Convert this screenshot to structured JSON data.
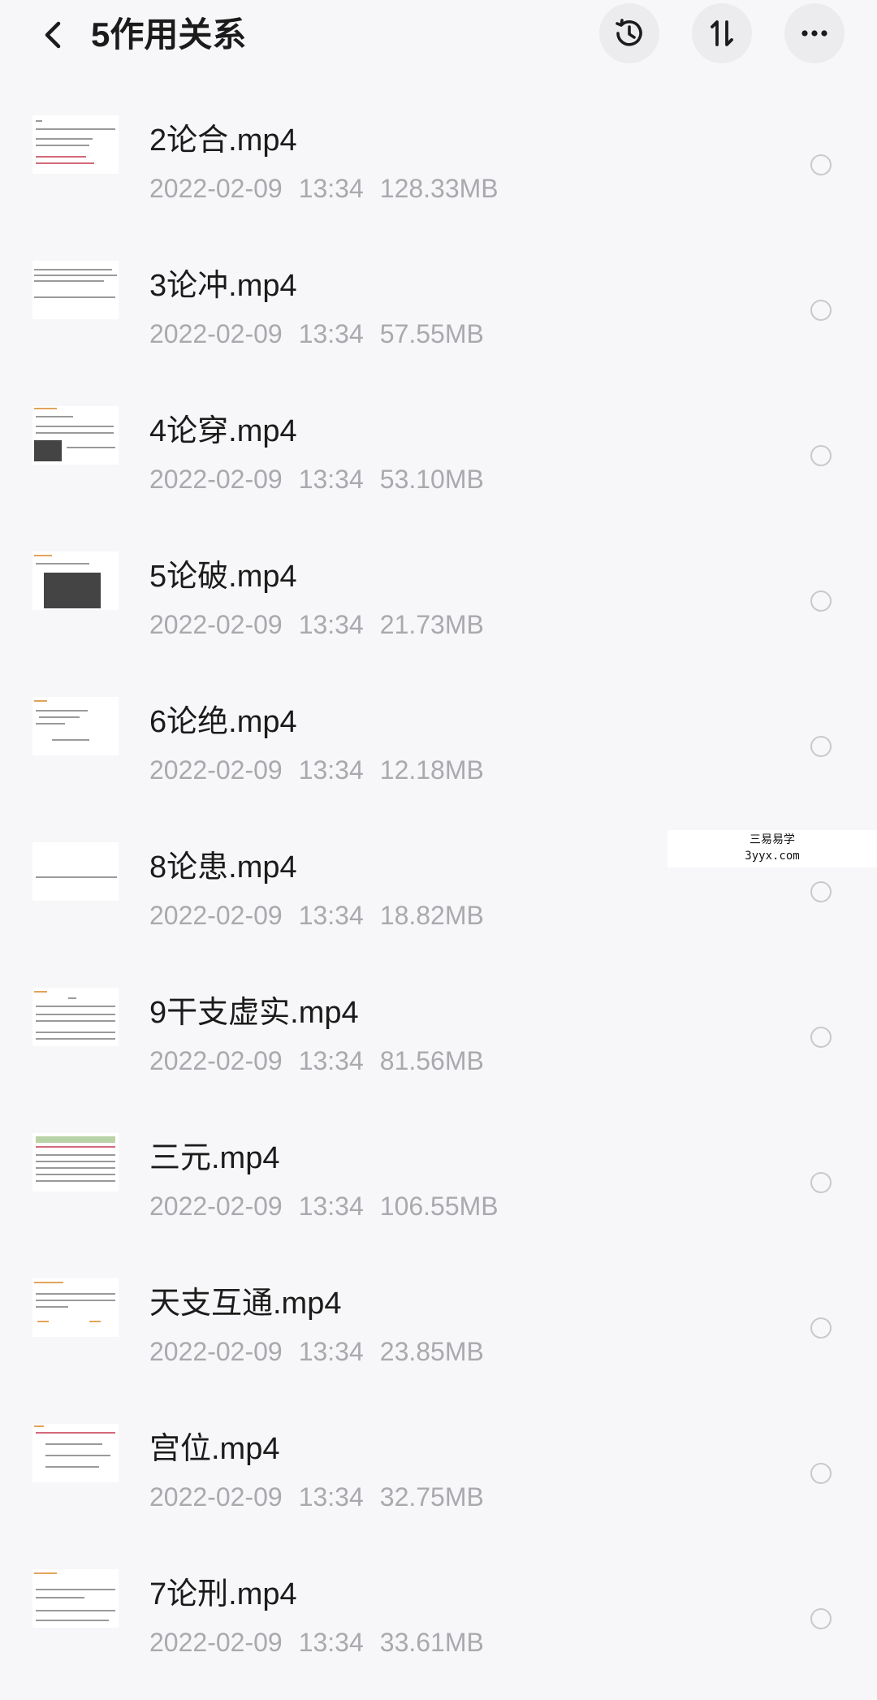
{
  "header": {
    "title": "5作用关系",
    "back_icon": "chevron-left-icon",
    "history_icon": "clock-history-icon",
    "sort_icon": "sort-icon",
    "more_icon": "more-horizontal-icon"
  },
  "files": [
    {
      "name": "2论合.mp4",
      "date": "2022-02-09",
      "time": "13:34",
      "size": "128.33MB"
    },
    {
      "name": "3论冲.mp4",
      "date": "2022-02-09",
      "time": "13:34",
      "size": "57.55MB"
    },
    {
      "name": "4论穿.mp4",
      "date": "2022-02-09",
      "time": "13:34",
      "size": "53.10MB"
    },
    {
      "name": "5论破.mp4",
      "date": "2022-02-09",
      "time": "13:34",
      "size": "21.73MB"
    },
    {
      "name": "6论绝.mp4",
      "date": "2022-02-09",
      "time": "13:34",
      "size": "12.18MB"
    },
    {
      "name": "8论患.mp4",
      "date": "2022-02-09",
      "time": "13:34",
      "size": "18.82MB"
    },
    {
      "name": "9干支虚实.mp4",
      "date": "2022-02-09",
      "time": "13:34",
      "size": "81.56MB"
    },
    {
      "name": "三元.mp4",
      "date": "2022-02-09",
      "time": "13:34",
      "size": "106.55MB"
    },
    {
      "name": "天支互通.mp4",
      "date": "2022-02-09",
      "time": "13:34",
      "size": "23.85MB"
    },
    {
      "name": "宫位.mp4",
      "date": "2022-02-09",
      "time": "13:34",
      "size": "32.75MB"
    },
    {
      "name": "7论刑.mp4",
      "date": "2022-02-09",
      "time": "13:34",
      "size": "33.61MB"
    }
  ],
  "watermark": {
    "line1": "三易易学",
    "line2": "3yyx.com"
  }
}
